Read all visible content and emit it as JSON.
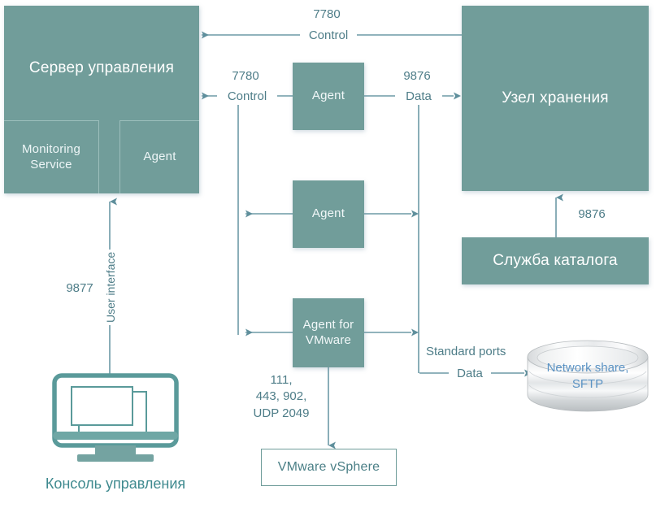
{
  "diagram": {
    "title": "Acronis backup architecture ports diagram",
    "colors": {
      "node_fill": "#719d9a",
      "wire": "#6d9aa6",
      "label_text": "#4e7d88",
      "caption_text": "#3f8a8f",
      "outline_border": "#6e9c9a",
      "cyl_text": "#5b93c4"
    }
  },
  "nodes": {
    "management_server": {
      "label": "Сервер управления"
    },
    "monitoring_service": {
      "label": "Monitoring\nService",
      "line1": "Monitoring",
      "line2": "Service"
    },
    "server_agent": {
      "label": "Agent"
    },
    "storage_node": {
      "label": "Узел хранения"
    },
    "catalog_service": {
      "label": "Служба каталога"
    },
    "agent_top": {
      "label": "Agent"
    },
    "agent_middle": {
      "label": "Agent"
    },
    "agent_vmware": {
      "line1": "Agent for",
      "line2": "VMware"
    },
    "vmware_vsphere": {
      "label": "VMware vSphere"
    },
    "network_share": {
      "line1": "Network share,",
      "line2": "SFTP"
    },
    "management_console": {
      "caption": "Консоль управления"
    }
  },
  "wire_labels": {
    "top_control_port": "7780",
    "top_control_kind": "Control",
    "left_control_port": "7780",
    "left_control_kind": "Control",
    "right_data_port": "9876",
    "right_data_kind": "Data",
    "catalog_port": "9876",
    "console_port": "9877",
    "console_kind": "User interface",
    "vsphere_ports_line1": "111,",
    "vsphere_ports_line2": "443, 902,",
    "vsphere_ports_line3": "UDP 2049",
    "share_kind_line1": "Standard ports",
    "share_kind_line2": "Data"
  }
}
